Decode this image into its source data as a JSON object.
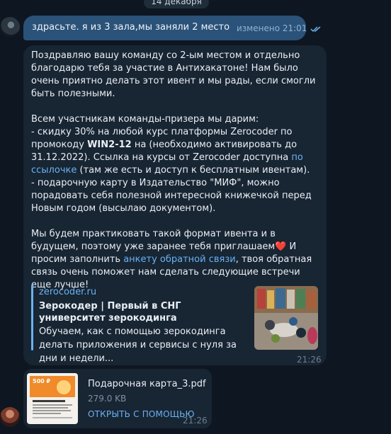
{
  "date_label": "14 декабря",
  "outgoing": {
    "text": "здрасьте. я из 3 зала,мы заняли 2 место",
    "meta": "изменено 21:01"
  },
  "incoming": {
    "p1": "Поздравляю вашу команду со 2-ым местом и отдельно благодарю тебя за участие в Антихакатоне! Нам было очень приятно делать этот ивент и мы рады, если смогли быть полезными.",
    "p2_intro": "Всем участникам команды-призера мы дарим:",
    "p2_b1a": "- скидку 30% на любой курс платформы Zerocoder по промокоду ",
    "promo": "WIN2-12",
    "p2_b1b": " на (необходимо активировать до 31.12.2022). Ссылка на курсы от Zerocoder доступна ",
    "link1": "по ссылочке",
    "p2_b1c": " (там же есть и доступ к бесплатным ивентам).",
    "p2_b2": "- подарочную карту в Издательство \"МИФ\", можно порадовать себя полезной интересной книжечкой перед Новым годом (высылаю документом).",
    "p3a": "Мы будем практиковать такой формат ивента и в будущем, поэтому уже заранее тебя приглашаем",
    "p3b": " И просим заполнить ",
    "link2": "анкету обратной связи",
    "p3c": ", твоя обратная связь очень поможет нам сделать следующие встречи еще лучше!",
    "preview": {
      "site": "zerocoder.ru",
      "title": "Зерокодер | Первый в СНГ университет зерокодинга",
      "description": "Обучаем, как с помощью зерокодинга делать приложения и сервисы с нуля за дни и недели..."
    },
    "time": "21:26"
  },
  "file": {
    "name": "Подарочная карта_3.pdf",
    "size": "279.0 KB",
    "open_label": "ОТКРЫТЬ С ПОМОЩЬЮ",
    "thumb_price": "500 ₽",
    "time": "21:26"
  },
  "colors": {
    "background": "#0e1621",
    "incoming_bubble": "#182533",
    "outgoing_bubble": "#2b5278",
    "link": "#6ab2f2"
  }
}
